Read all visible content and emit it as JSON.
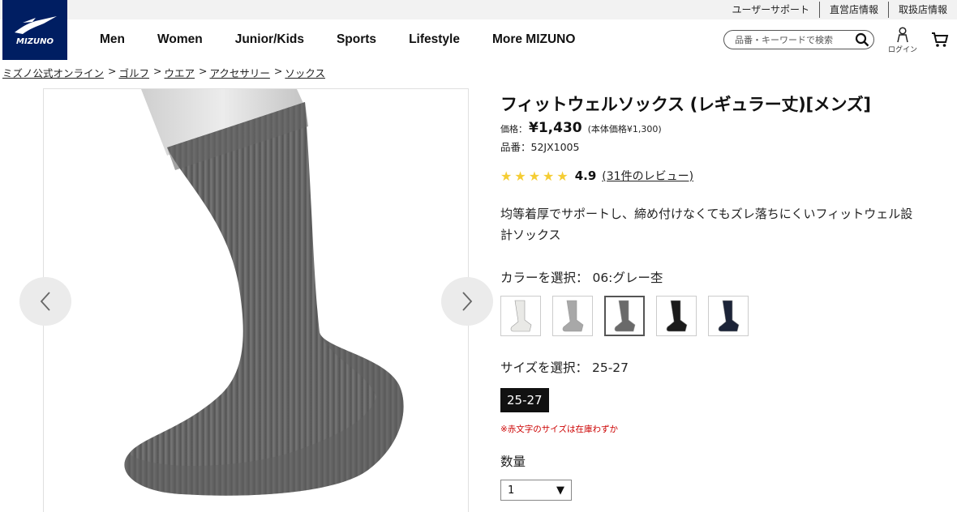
{
  "utility": {
    "support": "ユーザーサポート",
    "direct_stores": "直営店情報",
    "retailers": "取扱店情報"
  },
  "header": {
    "logo_text": "MIZUNO",
    "nav": [
      "Men",
      "Women",
      "Junior/Kids",
      "Sports",
      "Lifestyle",
      "More MIZUNO"
    ],
    "search_placeholder": "品番・キーワードで検索",
    "login_label": "ログイン"
  },
  "breadcrumb": [
    "ミズノ公式オンライン",
    "ゴルフ",
    "ウエア",
    "アクセサリー",
    "ソックス"
  ],
  "product": {
    "title": "フィットウェルソックス (レギュラー丈)[メンズ]",
    "price_label": "価格：",
    "price": "¥1,430",
    "price_base": "(本体価格¥1,300)",
    "sku": "品番：52JX1005",
    "stars": "★★★★★",
    "rating": "4.9",
    "reviews": "(31件のレビュー)",
    "description": "均等着厚でサポートし、締め付けなくてもズレ落ちにくいフィットウェル設計ソックス",
    "color_label": "カラーを選択：",
    "color_value": "06:グレー杢",
    "size_label": "サイズを選択：",
    "size_value": "25-27",
    "size_option": "25-27",
    "size_note": "※赤文字のサイズは在庫わずか",
    "qty_label": "数量",
    "qty_value": "1"
  },
  "swatches": [
    {
      "name": "white",
      "color": "#e9e9e6",
      "selected": false
    },
    {
      "name": "light-gray",
      "color": "#a8a8a8",
      "selected": false
    },
    {
      "name": "gray",
      "color": "#6a6a6a",
      "selected": true
    },
    {
      "name": "black",
      "color": "#1b1b1b",
      "selected": false
    },
    {
      "name": "navy",
      "color": "#1c2438",
      "selected": false
    }
  ],
  "colors": {
    "brand": "#001e62",
    "star": "#f5cd34",
    "alert": "#cc0000"
  }
}
